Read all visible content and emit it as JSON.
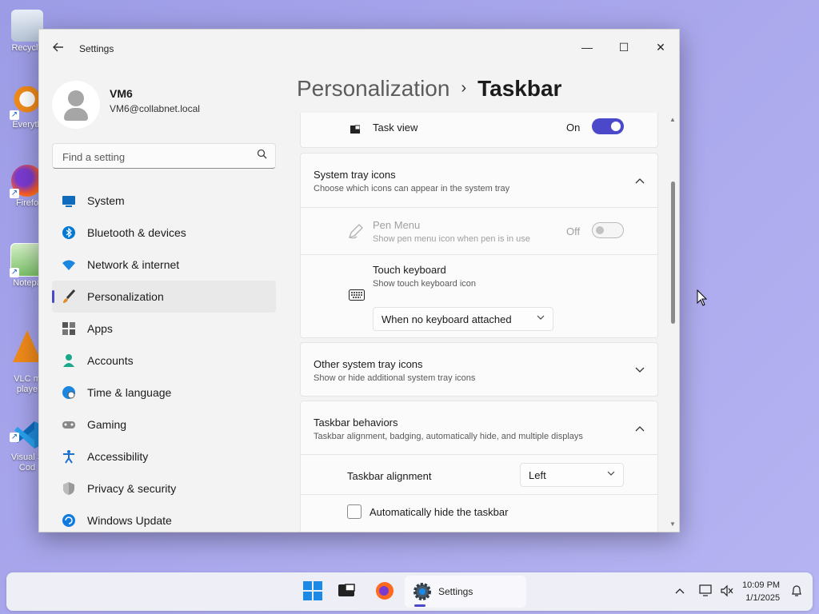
{
  "desktop": {
    "icons": [
      {
        "label": "Recycle"
      },
      {
        "label": "Everyth"
      },
      {
        "label": "Firefo"
      },
      {
        "label": "Notepa"
      },
      {
        "label": "VLC m\nplaye"
      },
      {
        "label": "Visual S\nCod"
      }
    ]
  },
  "window": {
    "title": "Settings",
    "back_icon": "back-arrow-icon",
    "controls": {
      "minimize": "—",
      "maximize": "☐",
      "close": "✕"
    }
  },
  "profile": {
    "name": "VM6",
    "email": "VM6@collabnet.local"
  },
  "search": {
    "placeholder": "Find a setting",
    "icon": "search-icon"
  },
  "nav": {
    "items": [
      {
        "label": "System",
        "icon": "system-icon",
        "color": "#0f6cbd"
      },
      {
        "label": "Bluetooth & devices",
        "icon": "bluetooth-icon",
        "color": "#0078d4"
      },
      {
        "label": "Network & internet",
        "icon": "wifi-icon",
        "color": "#1a86e0"
      },
      {
        "label": "Personalization",
        "icon": "brush-icon",
        "color": "#e08a2a"
      },
      {
        "label": "Apps",
        "icon": "apps-icon",
        "color": "#444"
      },
      {
        "label": "Accounts",
        "icon": "accounts-icon",
        "color": "#1aa88a"
      },
      {
        "label": "Time & language",
        "icon": "globe-icon",
        "color": "#1a86e0"
      },
      {
        "label": "Gaming",
        "icon": "gamepad-icon",
        "color": "#777"
      },
      {
        "label": "Accessibility",
        "icon": "accessibility-icon",
        "color": "#1a6fd0"
      },
      {
        "label": "Privacy & security",
        "icon": "shield-icon",
        "color": "#888"
      },
      {
        "label": "Windows Update",
        "icon": "update-icon",
        "color": "#0f7be0"
      }
    ],
    "active_index": 3
  },
  "breadcrumb": {
    "parent": "Personalization",
    "separator": "›",
    "current": "Taskbar"
  },
  "settings": {
    "task_view": {
      "label": "Task view",
      "state_label": "On"
    },
    "system_tray": {
      "title": "System tray icons",
      "subtitle": "Choose which icons can appear in the system tray",
      "pen_menu": {
        "title": "Pen Menu",
        "subtitle": "Show pen menu icon when pen is in use",
        "state_label": "Off"
      },
      "touch_keyboard": {
        "title": "Touch keyboard",
        "subtitle": "Show touch keyboard icon",
        "selected": "When no keyboard attached"
      }
    },
    "other_tray": {
      "title": "Other system tray icons",
      "subtitle": "Show or hide additional system tray icons"
    },
    "behaviors": {
      "title": "Taskbar behaviors",
      "subtitle": "Taskbar alignment, badging, automatically hide, and multiple displays",
      "alignment_label": "Taskbar alignment",
      "alignment_value": "Left",
      "autohide_label": "Automatically hide the taskbar"
    }
  },
  "taskbar": {
    "app_label": "Settings",
    "time": "10:09 PM",
    "date": "1/1/2025"
  },
  "colors": {
    "accent": "#4b49c9"
  }
}
